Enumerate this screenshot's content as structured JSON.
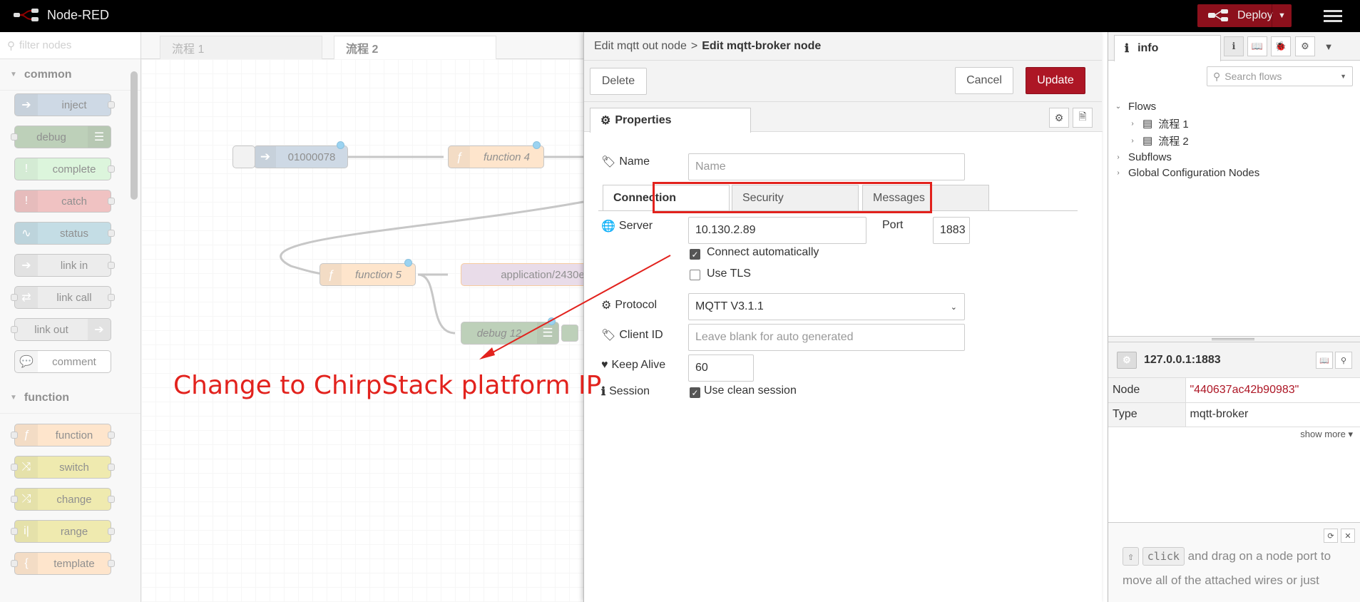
{
  "header": {
    "app_title": "Node-RED",
    "deploy_label": "Deploy"
  },
  "palette": {
    "filter_placeholder": "filter nodes",
    "categories": [
      {
        "label": "common",
        "nodes": [
          "inject",
          "debug",
          "complete",
          "catch",
          "status",
          "link in",
          "link call",
          "link out",
          "comment"
        ]
      },
      {
        "label": "function",
        "nodes": [
          "function",
          "switch",
          "change",
          "range",
          "template"
        ]
      }
    ]
  },
  "workspace": {
    "tabs": [
      "流程 1",
      "流程 2"
    ],
    "nodes": {
      "inject_label": "01000078",
      "function4_label": "function 4",
      "function5_label": "function 5",
      "mqtt_label": "application/2430e",
      "debug_label": "debug 12"
    }
  },
  "annotation": {
    "text": "Change to ChirpStack platform IP",
    "color": "#e2221d"
  },
  "tray": {
    "breadcrumb_parent": "Edit mqtt out node",
    "breadcrumb_sep": ">",
    "breadcrumb_current": "Edit mqtt-broker node",
    "delete_label": "Delete",
    "cancel_label": "Cancel",
    "update_label": "Update",
    "properties_tab": "Properties",
    "name_label": "Name",
    "name_placeholder": "Name",
    "subtabs": [
      "Connection",
      "Security",
      "Messages"
    ],
    "server_label": "Server",
    "server_value": "10.130.2.89",
    "port_label": "Port",
    "port_value": "1883",
    "connect_auto_label": "Connect automatically",
    "connect_auto_checked": true,
    "use_tls_label": "Use TLS",
    "use_tls_checked": false,
    "protocol_label": "Protocol",
    "protocol_value": "MQTT V3.1.1",
    "client_id_label": "Client ID",
    "client_id_placeholder": "Leave blank for auto generated",
    "keepalive_label": "Keep Alive",
    "keepalive_value": "60",
    "session_label": "Session",
    "clean_session_label": "Use clean session",
    "clean_session_checked": true
  },
  "sidebar": {
    "tab_label": "info",
    "search_placeholder": "Search flows",
    "tree": {
      "flows": "Flows",
      "flow_items": [
        "流程 1",
        "流程 2"
      ],
      "subflows": "Subflows",
      "global_config": "Global Configuration Nodes"
    },
    "node_title": "127.0.0.1:1883",
    "props": [
      {
        "key": "Node",
        "value": "\"440637ac42b90983\""
      },
      {
        "key": "Type",
        "value": "mqtt-broker"
      }
    ],
    "show_more": "show more",
    "help": {
      "key": "click",
      "text": "and drag on a node port to move all of the attached wires or just"
    }
  },
  "colors": {
    "header_bg": "#000000",
    "deploy_bg": "#8c101c",
    "update_bg": "#ad1625",
    "annotation_red": "#e2221d",
    "inject": "#a6bbcf",
    "debug": "#87a980",
    "complete": "#c0edc0",
    "catch": "#e49191",
    "status": "#94c1d0",
    "link": "#dddddd",
    "function": "#fdd0a2",
    "switch": "#e2d96e",
    "mqtt": "#d8bfd8"
  }
}
